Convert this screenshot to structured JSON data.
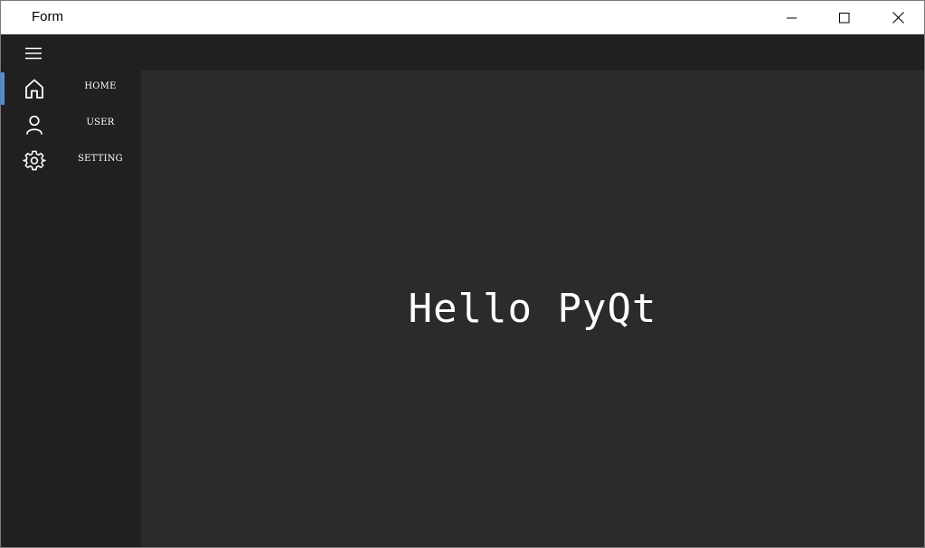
{
  "window": {
    "title": "Form"
  },
  "sidebar": {
    "items": [
      {
        "label": "HOME",
        "icon": "home-icon",
        "active": true
      },
      {
        "label": "USER",
        "icon": "user-icon",
        "active": false
      },
      {
        "label": "SETTING",
        "icon": "gear-icon",
        "active": false
      }
    ]
  },
  "main": {
    "text": "Hello PyQt"
  },
  "colors": {
    "accent": "#4a90e2",
    "sidebar_bg": "#202020",
    "content_bg": "#2b2b2b",
    "text": "#ffffff"
  }
}
